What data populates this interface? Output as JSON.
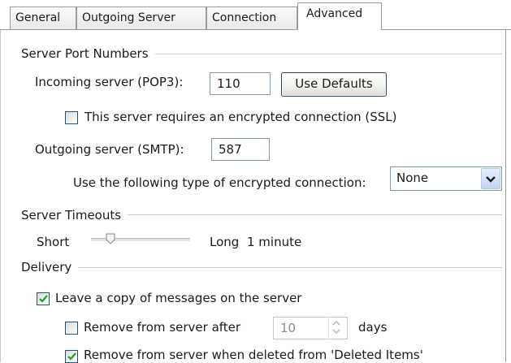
{
  "tabs": [
    {
      "label": "General"
    },
    {
      "label": "Outgoing Server"
    },
    {
      "label": "Connection"
    },
    {
      "label": "Advanced"
    }
  ],
  "active_tab": "Advanced",
  "server_ports": {
    "heading": "Server Port Numbers",
    "incoming_label": "Incoming server (POP3):",
    "incoming_value": "110",
    "use_defaults_label": "Use Defaults",
    "ssl_label": "This server requires an encrypted connection (SSL)",
    "ssl_checked": false,
    "outgoing_label": "Outgoing server (SMTP):",
    "outgoing_value": "587",
    "encryption_label": "Use the following type of encrypted connection:",
    "encryption_value": "None"
  },
  "timeouts": {
    "heading": "Server Timeouts",
    "short_label": "Short",
    "long_label": "Long",
    "timeout_value": "1 minute",
    "slider_level": 0.2
  },
  "delivery": {
    "heading": "Delivery",
    "leave_copy_label": "Leave a copy of messages on the server",
    "leave_copy_checked": true,
    "remove_after_label": "Remove from server after",
    "remove_after_checked": false,
    "remove_after_days": "10",
    "days_label": "days",
    "remove_deleted_label": "Remove from server when deleted from 'Deleted Items'",
    "remove_deleted_checked": true
  },
  "colors": {
    "accent_border": "#7f9db9",
    "check_mark": "#21a121",
    "tab_border": "#9a9a9a"
  }
}
